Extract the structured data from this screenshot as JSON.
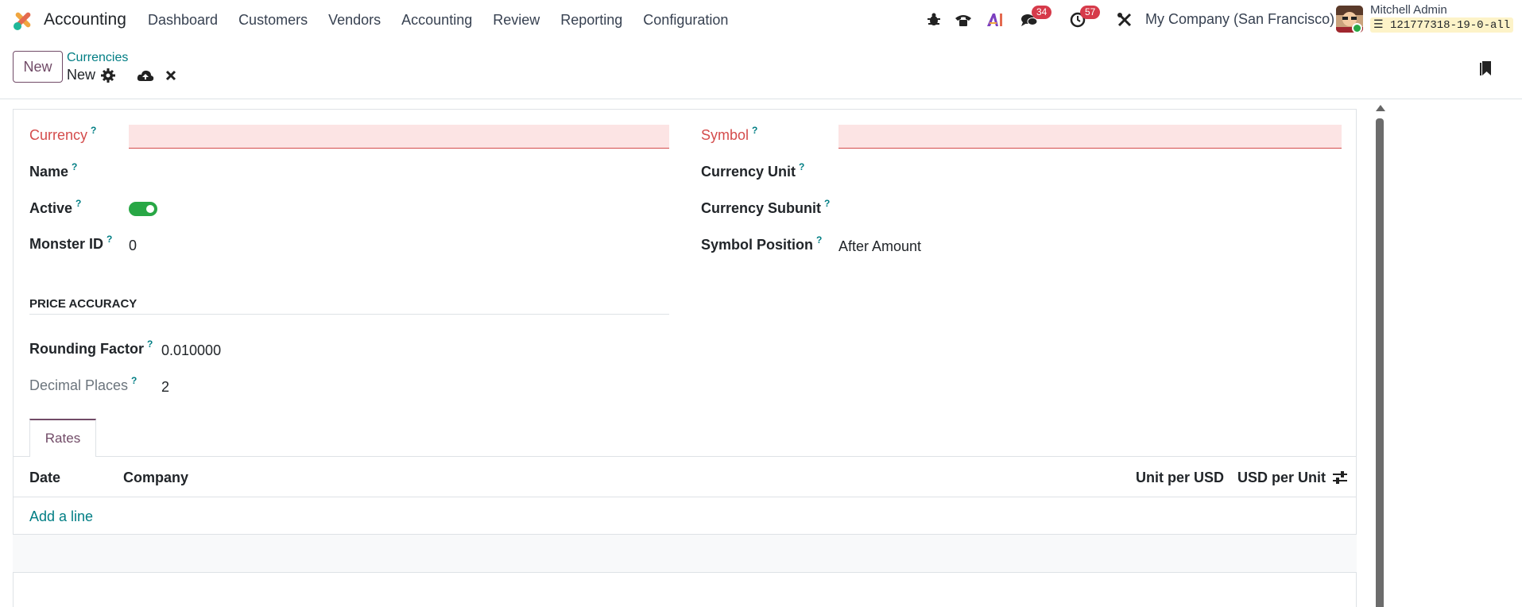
{
  "app": {
    "name": "Accounting"
  },
  "menu": [
    "Dashboard",
    "Customers",
    "Vendors",
    "Accounting",
    "Review",
    "Reporting",
    "Configuration"
  ],
  "systray": {
    "messages_count": "34",
    "activities_count": "57",
    "company": "My Company (San Francisco)",
    "user_name": "Mitchell Admin",
    "database": "121777318-19-0-all"
  },
  "control": {
    "new_button": "New",
    "breadcrumb_parent": "Currencies",
    "breadcrumb_current": "New"
  },
  "form": {
    "currency_label": "Currency",
    "currency_value": "",
    "name_label": "Name",
    "active_label": "Active",
    "monster_label": "Monster ID",
    "monster_value": "0",
    "symbol_label": "Symbol",
    "symbol_value": "",
    "unit_label": "Currency Unit",
    "subunit_label": "Currency Subunit",
    "position_label": "Symbol Position",
    "position_value": "After Amount",
    "section_title": "PRICE ACCURACY",
    "rounding_label": "Rounding Factor",
    "rounding_value": "0.010000",
    "decimal_label": "Decimal Places",
    "decimal_value": "2",
    "help_mark": "?"
  },
  "tabs": {
    "rates": "Rates"
  },
  "rates_table": {
    "columns": [
      "Date",
      "Company",
      "Unit per USD",
      "USD per Unit"
    ],
    "add_line": "Add a line"
  },
  "colors": {
    "brand": "#714b67",
    "link": "#017e84",
    "required": "#d44c4c",
    "toggle_on": "#28a745",
    "badge": "#d63a4a"
  }
}
